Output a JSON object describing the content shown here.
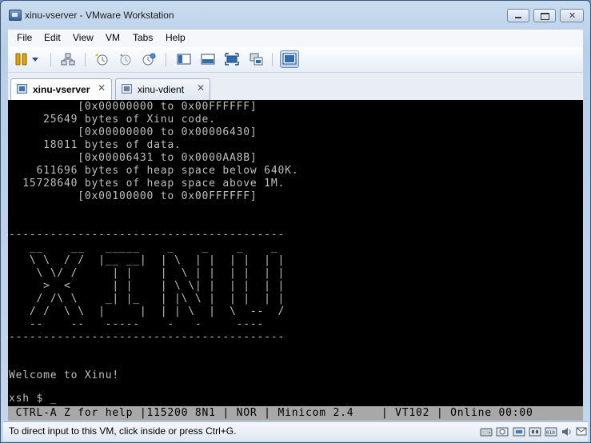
{
  "window": {
    "title": "xinu-vserver - VMware Workstation"
  },
  "menu": [
    {
      "label": "File"
    },
    {
      "label": "Edit"
    },
    {
      "label": "View"
    },
    {
      "label": "VM"
    },
    {
      "label": "Tabs"
    },
    {
      "label": "Help"
    }
  ],
  "toolbar": {
    "icons": [
      "power-pause-icon",
      "dropdown-arrow-icon",
      "network-icon",
      "snapshot-icon",
      "revert-snapshot-icon",
      "snapshot-manager-icon",
      "console-view-icon",
      "quick-switch-icon",
      "full-screen-icon",
      "unity-icon",
      "thumbnail-view-icon"
    ]
  },
  "tabs": [
    {
      "label": "xinu-vserver",
      "active": true
    },
    {
      "label": "xinu-vdient",
      "active": false
    }
  ],
  "terminal": {
    "lines": [
      "          [0x00000000 to 0x00FFFFFF]",
      "     25649 bytes of Xinu code.",
      "          [0x00000000 to 0x00006430]",
      "     18011 bytes of data.",
      "          [0x00006431 to 0x0000AA8B]",
      "    611696 bytes of heap space below 640K.",
      "  15728640 bytes of heap space above 1M.",
      "          [0x00100000 to 0x00FFFFFF]",
      "",
      "",
      "----------------------------------------",
      "   __    __   _____    _    _    _    _",
      "   \\ \\  / /  |__ __|  | \\  | |  | |  | |",
      "    \\ \\/ /     | |    |  \\ | |  | |  | |",
      "     >  <      | |    | \\ \\| |  | |  | |",
      "    / /\\ \\    _| |_   | |\\ \\ |  | |  | |",
      "   / /  \\ \\  |     |  | | \\  |  \\  --  /",
      "   --    --   -----    -   -     ----",
      "----------------------------------------",
      "",
      "",
      "Welcome to Xinu!",
      "",
      "",
      "xsh $ _"
    ],
    "status_line": " CTRL-A Z for help |115200 8N1 | NOR | Minicom 2.4    | VT102 | Online 00:00"
  },
  "bottom": {
    "hint": "To direct input to this VM, click inside or press Ctrl+G.",
    "devices": [
      "hard-disk-icon",
      "cd-drive-icon",
      "network-adapter-icon",
      "usb-icon",
      "serial-port-icon",
      "sound-icon",
      "message-icon"
    ]
  }
}
